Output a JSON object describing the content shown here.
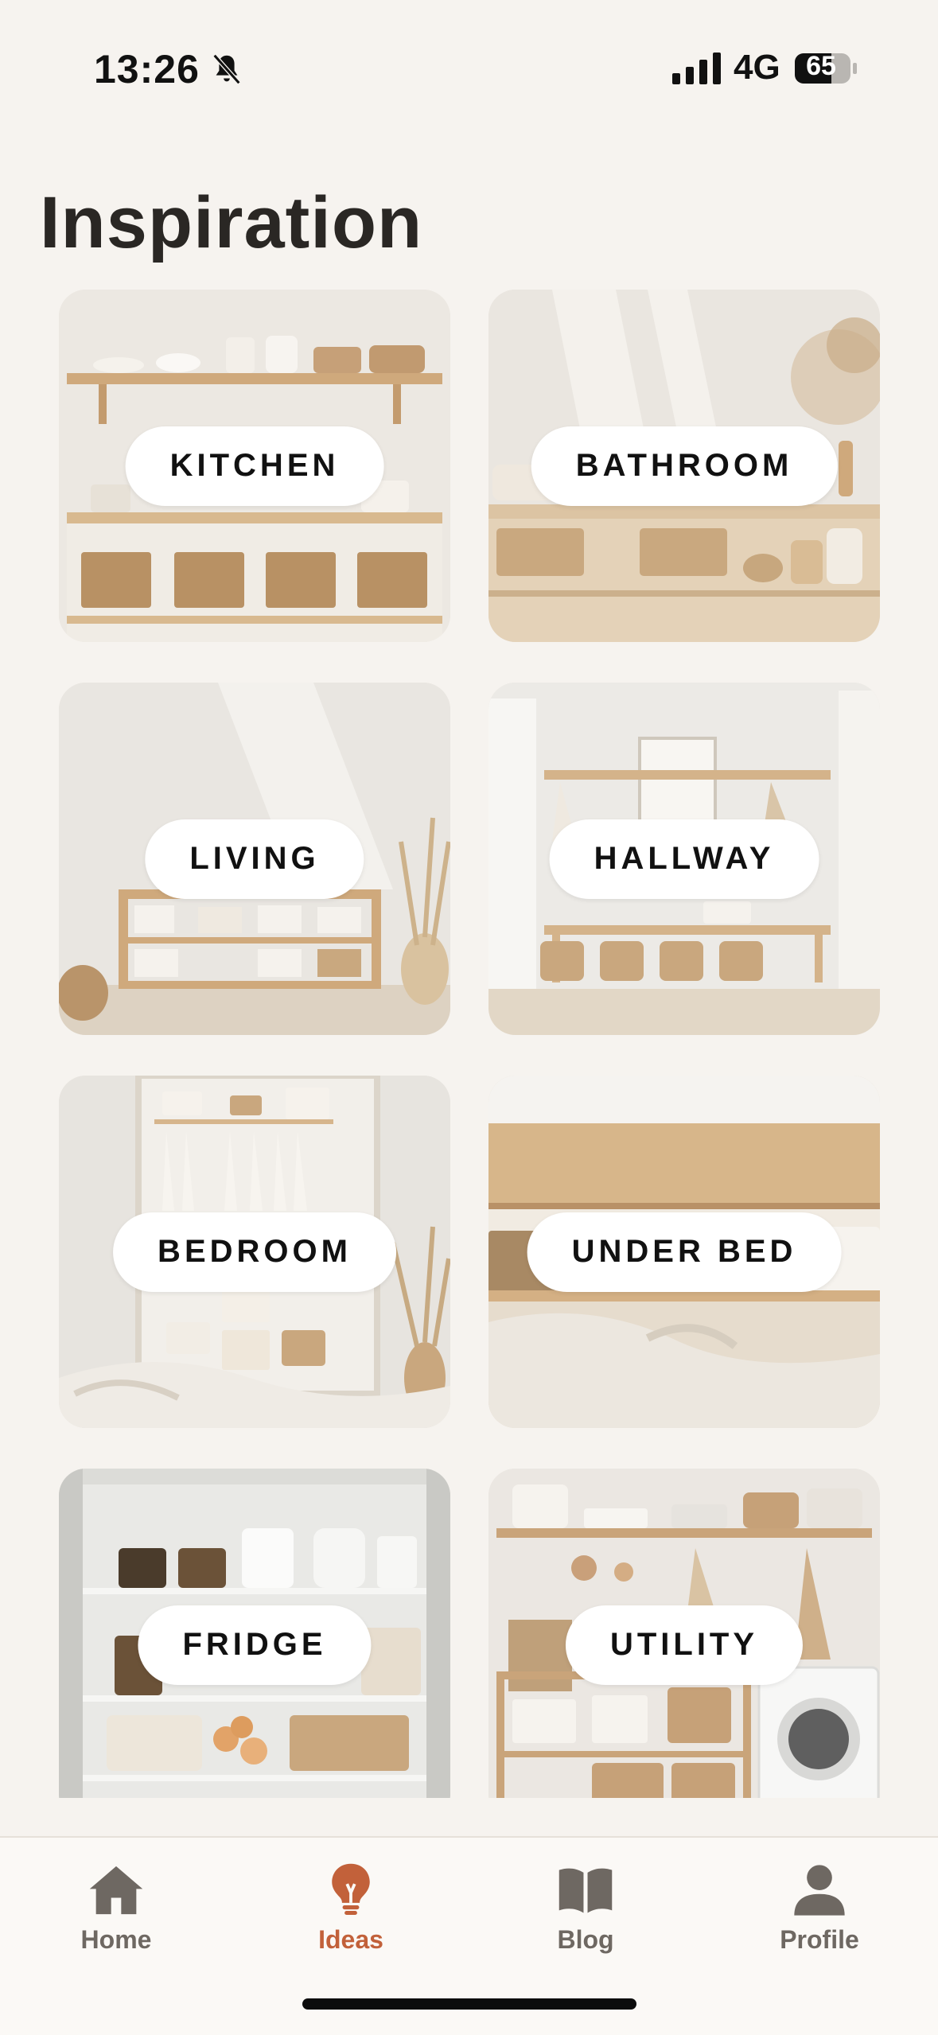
{
  "status": {
    "time": "13:26",
    "network": "4G",
    "battery": "65"
  },
  "page": {
    "title": "Inspiration"
  },
  "categories": [
    {
      "label": "KITCHEN"
    },
    {
      "label": "BATHROOM"
    },
    {
      "label": "LIVING"
    },
    {
      "label": "HALLWAY"
    },
    {
      "label": "BEDROOM"
    },
    {
      "label": "UNDER BED"
    },
    {
      "label": "FRIDGE"
    },
    {
      "label": "UTILITY"
    }
  ],
  "tabs": [
    {
      "label": "Home",
      "icon": "home-icon"
    },
    {
      "label": "Ideas",
      "icon": "lightbulb-icon",
      "active": true
    },
    {
      "label": "Blog",
      "icon": "book-icon"
    },
    {
      "label": "Profile",
      "icon": "person-icon"
    }
  ],
  "colors": {
    "background": "#f6f3ef",
    "accent": "#c2613a",
    "tab_inactive": "#6e6862"
  }
}
